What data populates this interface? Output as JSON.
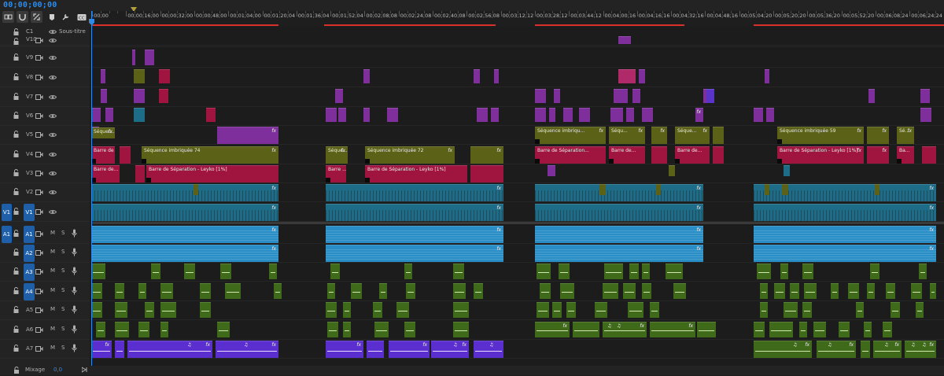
{
  "timecode": "00;00;00;00",
  "ruler": {
    "labels": [
      ":00;00",
      "00;00;16;00",
      "00;00;32;00",
      "00;00;48;00",
      "00;01;04;00",
      "00;01;20;04",
      "00;01;36;04",
      "00;01;52;04",
      "00;02;08;08",
      "00;02;24;08",
      "00;02;40;08",
      "00;02;56;08",
      "00;03;12;12",
      "00;03;28;12",
      "00;03;44;12",
      "00;04;00;16",
      "00;04;16;16",
      "00;04;32;16",
      "00;04;48;16",
      "00;05;04;20",
      "00;05;20;20",
      "00;05;36;20",
      "00;05;52;20",
      "00;06;08;24",
      "00;06;24;24"
    ]
  },
  "tracks": {
    "caption": {
      "name": "C1",
      "label": "Sous-titre"
    },
    "video": [
      "V10",
      "V9",
      "V8",
      "V7",
      "V6",
      "V5",
      "V4",
      "V3",
      "V2",
      "V1"
    ],
    "audio": [
      "A1",
      "A2",
      "A3",
      "A4",
      "A5",
      "A6",
      "A7"
    ],
    "source_video": "V1",
    "source_audio": "A1",
    "mute_label": "M",
    "solo_label": "S"
  },
  "footer": {
    "mix_label": "Mixage",
    "mix_value": "0,0"
  },
  "clips": {
    "seq_a": "Séquen...",
    "seq_74": "Séquence imbriquée 74",
    "seq_b": "Séque...",
    "seq_72": "Séquence imbriquée 72",
    "seq_c": "Séquence imbriqu...",
    "seq_d": "Séqu...",
    "seq_e": "Séque...",
    "seq_59": "Séquence imbriquée 59",
    "seq_f": "Sé...",
    "barre_a": "Barre de...",
    "barre_leyko": "Barre de Séparation - Leyko [1%]",
    "barre_b": "Barre ...",
    "barre_leyko2": "Barre de Séparation - Leyko [1%]",
    "barre_c": "Barre de Séparation...",
    "barre_d": "Barre de...",
    "barre_e": "Barre de...",
    "barre_f": "Barre de Séparation - Leyko [1%]",
    "barre_g": "Ba...",
    "fx": "fx",
    "note": "♫"
  },
  "colors": {
    "accent": "#2d8ceb",
    "render_red": "#d7312a",
    "video_teal": "#1d6d89",
    "audio_blue": "#2a8ec6",
    "audio_green": "#3f6a1a",
    "audio_purple": "#5b2ed0",
    "olive": "#5b6116",
    "crimson": "#9f1540",
    "violet": "#7e2f9b"
  }
}
